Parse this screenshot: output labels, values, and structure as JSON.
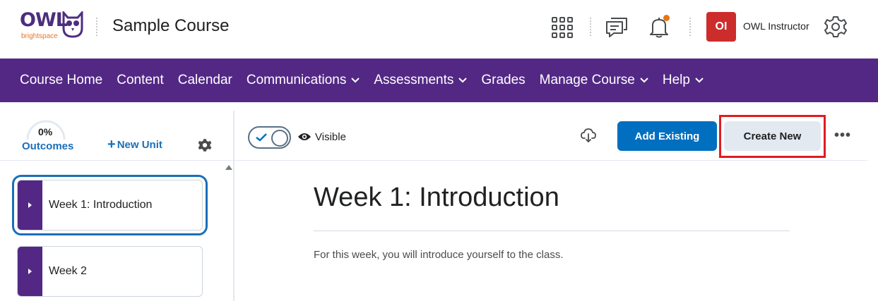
{
  "brand": {
    "logo_text": "OWL",
    "logo_subtext": "brightspace"
  },
  "header": {
    "course_title": "Sample Course",
    "user": {
      "initials": "OI",
      "name": "OWL Instructor",
      "avatar_color": "#cd2c2c"
    },
    "icons": [
      "apps-grid-icon",
      "message-icon",
      "bell-icon",
      "gear-icon"
    ],
    "notification_dot_color": "#e87511"
  },
  "nav": {
    "background": "#532885",
    "items": [
      {
        "label": "Course Home",
        "dropdown": false
      },
      {
        "label": "Content",
        "dropdown": false
      },
      {
        "label": "Calendar",
        "dropdown": false
      },
      {
        "label": "Communications",
        "dropdown": true
      },
      {
        "label": "Assessments",
        "dropdown": true
      },
      {
        "label": "Grades",
        "dropdown": false
      },
      {
        "label": "Manage Course",
        "dropdown": true
      },
      {
        "label": "Help",
        "dropdown": true
      }
    ]
  },
  "sidebar": {
    "progress_value": "0%",
    "outcomes_label": "Outcomes",
    "new_unit_label": "New Unit",
    "units": [
      {
        "label": "Week 1: Introduction",
        "selected": true
      },
      {
        "label": "Week 2",
        "selected": false
      }
    ]
  },
  "toolbar": {
    "visibility_label": "Visible",
    "add_existing_label": "Add Existing",
    "create_new_label": "Create New",
    "accent_color": "#006fbf",
    "highlight_color": "#e01b22"
  },
  "content": {
    "title": "Week 1: Introduction",
    "description": "For this week, you will introduce yourself to the class."
  }
}
